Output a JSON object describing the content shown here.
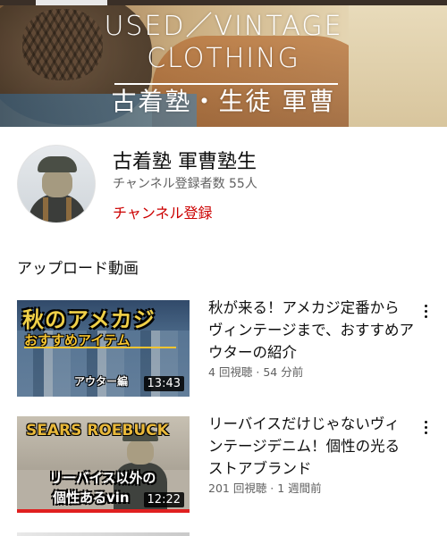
{
  "banner": {
    "line1": "USED／VINTAGE",
    "line2": "CLOTHING",
    "line3": "古着塾・生徒 軍曹"
  },
  "channel": {
    "name": "古着塾 軍曹塾生",
    "subscribers": "チャンネル登録者数 55人",
    "subscribe_label": "チャンネル登録",
    "accent_color": "#cc0000"
  },
  "section": {
    "title": "アップロード動画"
  },
  "videos": [
    {
      "title": "秋が来る！アメカジ定番からヴィンテージまで、おすすめアウターの紹介",
      "meta": "4 回視聴 · 54 分前",
      "duration": "13:43",
      "thumb_text_1": "秋のアメカジ",
      "thumb_text_2": "おすすめアイテム",
      "thumb_text_3": "アウター編"
    },
    {
      "title": "リーバイスだけじゃないヴィンテージデニム！個性の光るストアブランド",
      "meta": "201 回視聴 · 1 週間前",
      "duration": "12:22",
      "thumb_text_1": "SEARS ROEBUCK",
      "thumb_text_2": "リーバイス以外の",
      "thumb_text_3": "個性あるvin"
    }
  ]
}
